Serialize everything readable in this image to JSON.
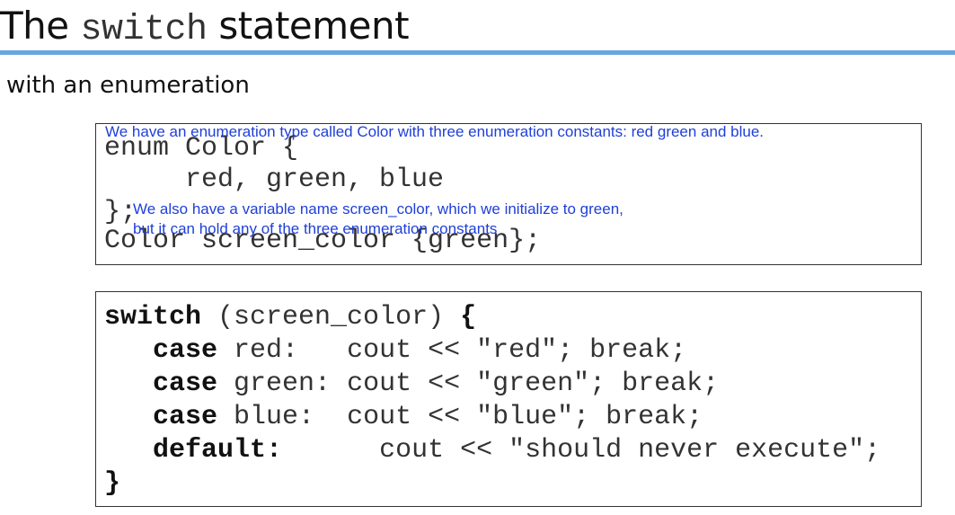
{
  "slide": {
    "title_prefix": "The ",
    "title_code": "switch",
    "title_suffix": " statement",
    "subtitle": "with an enumeration"
  },
  "enum_block": {
    "lines": [
      "enum Color {",
      "     red, green, blue",
      "};",
      "Color screen_color {green};"
    ],
    "notes": [
      "We have an enumeration type called Color with three enumeration constants: red green and blue.",
      "We also have a variable name screen_color, which we initialize to green,",
      "but it can hold any of the three enumeration constants"
    ]
  },
  "switch_block": {
    "line1_kw": "switch",
    "line1_rest": " (screen_color) ",
    "line1_brace": "{",
    "cases": [
      {
        "kw": "case",
        "label": " red:   ",
        "stmt": "cout << \"red\"; break;"
      },
      {
        "kw": "case",
        "label": " green: ",
        "stmt": "cout << \"green\"; break;"
      },
      {
        "kw": "case",
        "label": " blue:  ",
        "stmt": "cout << \"blue\"; break;"
      },
      {
        "kw": "default:",
        "label": "      ",
        "stmt": "cout << \"should never execute\";"
      }
    ],
    "closing_brace": "}"
  },
  "colors": {
    "accent_rule": "#6aa6e0",
    "annotation_text": "#1f3fd8",
    "code_text": "#333333"
  }
}
